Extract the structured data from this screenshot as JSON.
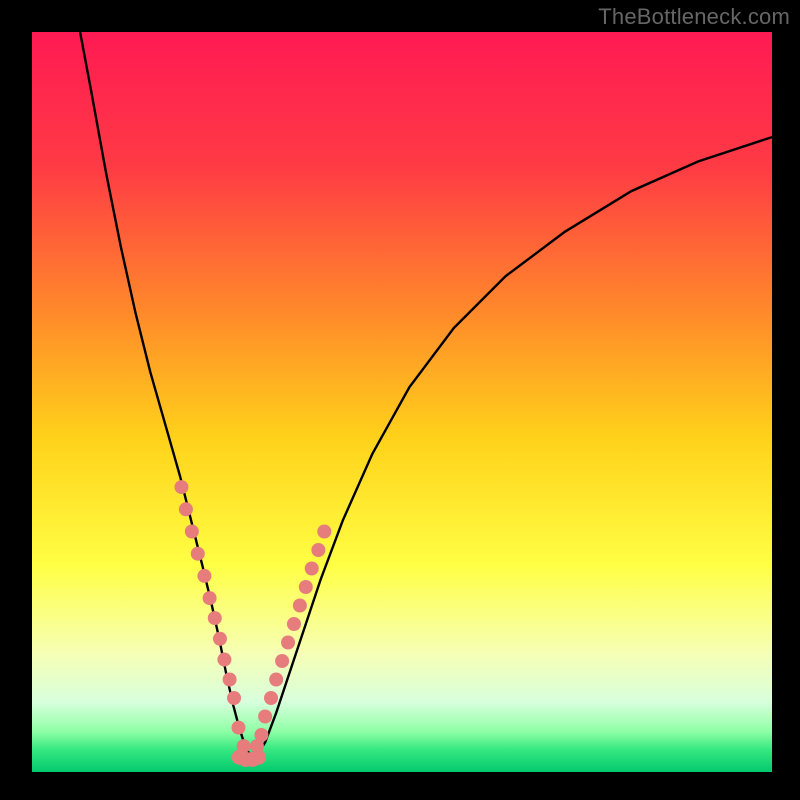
{
  "watermark": "TheBottleneck.com",
  "colors": {
    "frame": "#000000",
    "curve": "#000000",
    "dot": "#e77c7d",
    "gradient_stops": [
      {
        "offset": 0.0,
        "color": "#ff1a53"
      },
      {
        "offset": 0.18,
        "color": "#ff3a45"
      },
      {
        "offset": 0.38,
        "color": "#ff8a2a"
      },
      {
        "offset": 0.55,
        "color": "#ffd21a"
      },
      {
        "offset": 0.72,
        "color": "#ffff44"
      },
      {
        "offset": 0.84,
        "color": "#f6ffb5"
      },
      {
        "offset": 0.905,
        "color": "#d8ffdc"
      },
      {
        "offset": 0.945,
        "color": "#8fffa6"
      },
      {
        "offset": 0.97,
        "color": "#35e880"
      },
      {
        "offset": 1.0,
        "color": "#03c96e"
      }
    ]
  },
  "chart_data": {
    "type": "line",
    "title": "",
    "xlabel": "",
    "ylabel": "",
    "xlim": [
      0,
      100
    ],
    "ylim": [
      0,
      100
    ],
    "x": [
      6.5,
      8,
      10,
      12,
      14,
      16,
      18,
      20,
      21.5,
      23,
      24.2,
      25.3,
      26.3,
      27.2,
      28,
      28.8,
      29.6,
      30.4,
      31.5,
      33,
      35,
      37,
      39,
      42,
      46,
      51,
      57,
      64,
      72,
      81,
      90,
      100
    ],
    "values": [
      100,
      92,
      81,
      71,
      62,
      54,
      47,
      40,
      34,
      28,
      23,
      18,
      13,
      9,
      6,
      3.5,
      2,
      2.3,
      4,
      8,
      14,
      20,
      26,
      34,
      43,
      52,
      60,
      67,
      73,
      78.5,
      82.5,
      85.8
    ],
    "series": [
      {
        "name": "points-left",
        "x": [
          20.2,
          20.8,
          21.6,
          22.4,
          23.3,
          24.0,
          24.7,
          25.4,
          26.0,
          26.7,
          27.3,
          27.9,
          28.6
        ],
        "values": [
          38.5,
          35.5,
          32.5,
          29.5,
          26.5,
          23.5,
          20.8,
          18.0,
          15.2,
          12.5,
          10.0,
          6.0,
          3.5
        ]
      },
      {
        "name": "points-right",
        "x": [
          30.4,
          31.0,
          31.5,
          32.3,
          33.0,
          33.8,
          34.6,
          35.4,
          36.2,
          37.0,
          37.8,
          38.7,
          39.5
        ],
        "values": [
          3.5,
          5.0,
          7.5,
          10.0,
          12.5,
          15.0,
          17.5,
          20.0,
          22.5,
          25.0,
          27.5,
          30.0,
          32.5
        ]
      },
      {
        "name": "points-bottom",
        "x": [
          28.0,
          28.9,
          29.8,
          30.6
        ],
        "values": [
          2.0,
          1.7,
          1.7,
          2.0
        ]
      }
    ]
  }
}
